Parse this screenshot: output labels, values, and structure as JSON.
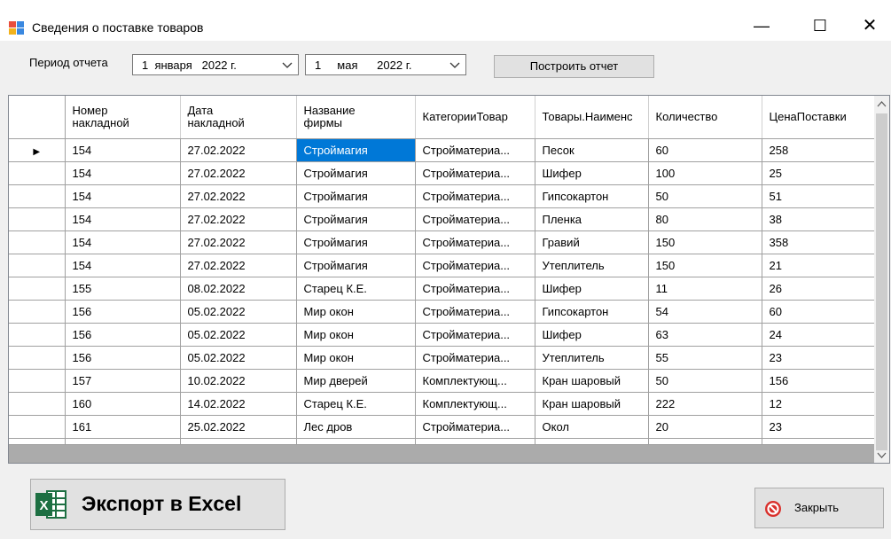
{
  "window": {
    "title": "Сведения о поставке товаров",
    "minimize": "—",
    "maximize": "☐",
    "close": "✕"
  },
  "toolbar": {
    "period_label": "Период отчета",
    "date_from": "1  января   2022 г.",
    "date_to": "1     мая      2022 г.",
    "build_button": "Построить отчет"
  },
  "grid": {
    "columns": [
      {
        "line1": "Номер",
        "line2": "накладной"
      },
      {
        "line1": "Дата",
        "line2": "накладной"
      },
      {
        "line1": "Название",
        "line2": "фирмы"
      },
      {
        "line1": "КатегорииТовар",
        "line2": ""
      },
      {
        "line1": "Товары.Наименс",
        "line2": ""
      },
      {
        "line1": "Количество",
        "line2": ""
      },
      {
        "line1": "ЦенаПоставки",
        "line2": ""
      }
    ],
    "rows": [
      [
        "154",
        "27.02.2022",
        "Строймагия",
        "Стройматериа...",
        "Песок",
        "60",
        "258"
      ],
      [
        "154",
        "27.02.2022",
        "Строймагия",
        "Стройматериа...",
        "Шифер",
        "100",
        "25"
      ],
      [
        "154",
        "27.02.2022",
        "Строймагия",
        "Стройматериа...",
        "Гипсокартон",
        "50",
        "51"
      ],
      [
        "154",
        "27.02.2022",
        "Строймагия",
        "Стройматериа...",
        "Пленка",
        "80",
        "38"
      ],
      [
        "154",
        "27.02.2022",
        "Строймагия",
        "Стройматериа...",
        "Гравий",
        "150",
        "358"
      ],
      [
        "154",
        "27.02.2022",
        "Строймагия",
        "Стройматериа...",
        "Утеплитель",
        "150",
        "21"
      ],
      [
        "155",
        "08.02.2022",
        "Старец К.Е.",
        "Стройматериа...",
        "Шифер",
        "11",
        "26"
      ],
      [
        "156",
        "05.02.2022",
        "Мир окон",
        "Стройматериа...",
        "Гипсокартон",
        "54",
        "60"
      ],
      [
        "156",
        "05.02.2022",
        "Мир окон",
        "Стройматериа...",
        "Шифер",
        "63",
        "24"
      ],
      [
        "156",
        "05.02.2022",
        "Мир окон",
        "Стройматериа...",
        "Утеплитель",
        "55",
        "23"
      ],
      [
        "157",
        "10.02.2022",
        "Мир дверей",
        "Комплектующ...",
        "Кран шаровый",
        "50",
        "156"
      ],
      [
        "160",
        "14.02.2022",
        "Старец К.Е.",
        "Комплектующ...",
        "Кран шаровый",
        "222",
        "12"
      ],
      [
        "161",
        "25.02.2022",
        "Лес дров",
        "Стройматериа...",
        "Окол",
        "20",
        "23"
      ]
    ],
    "current_row_marker": "▶"
  },
  "footer": {
    "excel_button": "Экспорт в Excel",
    "close_button": "Закрыть"
  },
  "colors": {
    "selection": "#0078d7",
    "excel_green": "#1d6f42",
    "close_red": "#d9302c"
  },
  "icons": [
    "app-icon",
    "chevron-down-icon",
    "excel-icon",
    "close-circle-icon",
    "row-pointer-icon"
  ]
}
